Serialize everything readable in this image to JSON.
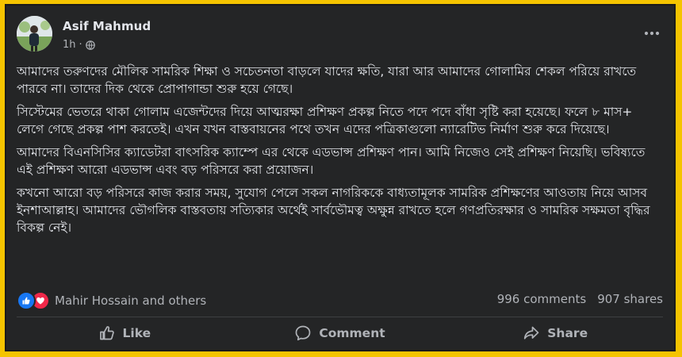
{
  "post": {
    "author": "Asif Mahmud",
    "time": "1h",
    "separator": "·",
    "audience_icon": "globe-icon",
    "paragraphs": [
      "আমাদের তরুণদের মৌলিক সামরিক শিক্ষা ও সচেতনতা বাড়লে যাদের ক্ষতি, যারা আর আমাদের গোলামির শেকল পরিয়ে রাখতে পারবে না। তাদের দিক থেকে প্রোপাগান্ডা শুরু হয়ে গেছে।",
      "সিস্টেমের ভেতরে থাকা গোলাম এজেন্টদের দিয়ে আত্মরক্ষা প্রশিক্ষণ প্রকল্প নিতে পদে পদে বাঁধা সৃষ্টি করা হয়েছে। ফলে ৮ মাস+ লেগে গেছে প্রকল্প পাশ করতেই। এখন যখন বাস্তবায়নের পথে তখন এদের পত্রিকাগুলো ন্যারেটিভ নির্মাণ শুরু করে দিয়েছে।",
      "আমাদের বিএনসিসির ক্যাডেটরা বাৎসরিক ক্যাম্পে এর থেকে এডভান্স প্রশিক্ষণ পান। আমি নিজেও সেই প্রশিক্ষণ নিয়েছি। ভবিষ্যতে এই প্রশিক্ষণ আরো এডভান্স এবং বড় পরিসরে করা প্রয়োজন।",
      "কখনো আরো বড় পরিসরে কাজ করার সময়, সুযোগ পেলে সকল নাগরিককে বাধ্যতামূলক সামরিক প্রশিক্ষণের আওতায় নিয়ে আসব ইনশাআল্লাহ। আমাদের ভৌগলিক বাস্তবতায় সত্যিকার অর্থেই সার্বভৌমত্ব অক্ষুন্ন রাখতে হলে গণপ্রতিরক্ষার ও সামরিক সক্ষমতা বৃদ্ধির বিকল্প নেই।"
    ]
  },
  "stats": {
    "reactors": "Mahir Hossain and others",
    "comments": "996 comments",
    "shares": "907 shares"
  },
  "actions": {
    "like": "Like",
    "comment": "Comment",
    "share": "Share"
  },
  "colors": {
    "background": "#f5c400",
    "card": "#242526",
    "text": "#e4e6eb",
    "muted": "#b0b3b8",
    "like": "#1877f2",
    "love": "#f02849"
  }
}
